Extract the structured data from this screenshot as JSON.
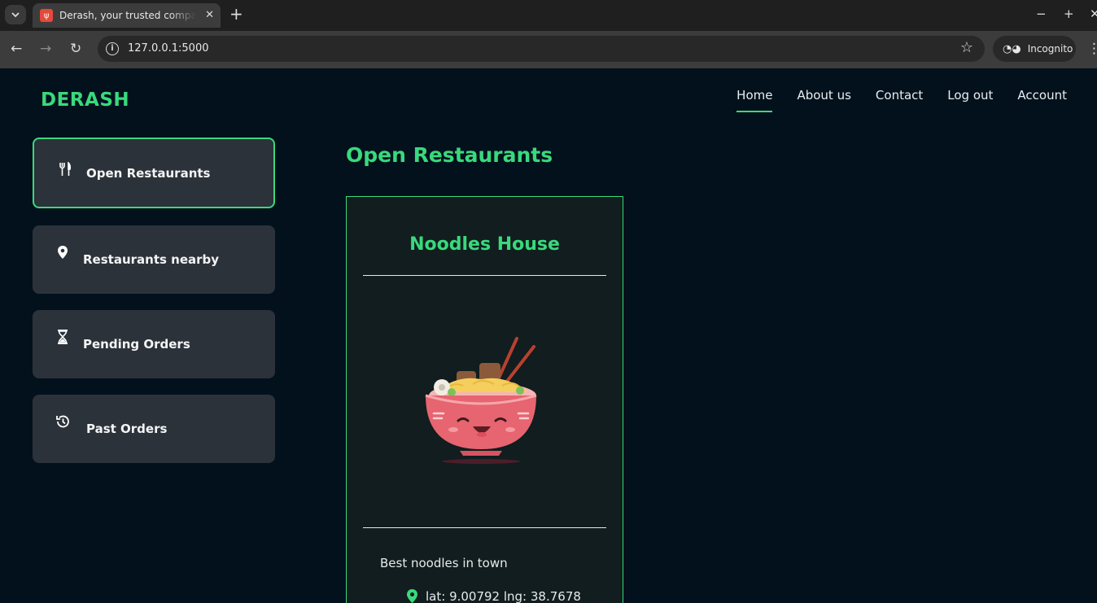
{
  "browser": {
    "tab_title": "Derash, your trusted companion",
    "new_tab": "+",
    "close": "✕",
    "url": "127.0.0.1:5000",
    "incognito_label": "Incognito"
  },
  "header": {
    "brand": "DERASH",
    "nav": [
      "Home",
      "About us",
      "Contact",
      "Log out",
      "Account"
    ],
    "active_nav": "Home"
  },
  "sidebar": {
    "items": [
      {
        "label": "Open Restaurants",
        "icon": "utensils-icon",
        "active": true
      },
      {
        "label": "Restaurants nearby",
        "icon": "map-pin-icon",
        "active": false
      },
      {
        "label": "Pending Orders",
        "icon": "hourglass-icon",
        "active": false
      },
      {
        "label": "Past Orders",
        "icon": "history-icon",
        "active": false
      }
    ]
  },
  "main": {
    "title": "Open Restaurants",
    "restaurants": [
      {
        "name": "Noodles House",
        "image": "noodle-bowl-illustration",
        "description": "Best noodles in town",
        "location": "lat: 9.00792 lng: 38.7678"
      }
    ]
  },
  "colors": {
    "accent": "#39d97c",
    "background": "#03111d",
    "sidebar_button": "#2b323a",
    "card": "#111d1e"
  }
}
